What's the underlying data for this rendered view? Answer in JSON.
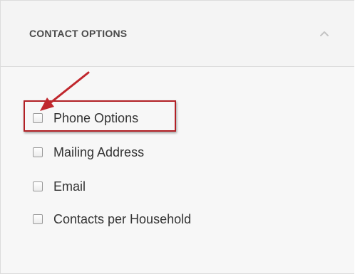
{
  "panel": {
    "title": "CONTACT OPTIONS",
    "collapse_icon": "chevron-up-icon"
  },
  "options": [
    {
      "label": "Phone Options",
      "checked": false
    },
    {
      "label": "Mailing Address",
      "checked": false
    },
    {
      "label": "Email",
      "checked": false
    },
    {
      "label": "Contacts per Household",
      "checked": false
    }
  ],
  "annotation": {
    "color": "#b22025",
    "icon": "pointer-arrow-icon"
  }
}
